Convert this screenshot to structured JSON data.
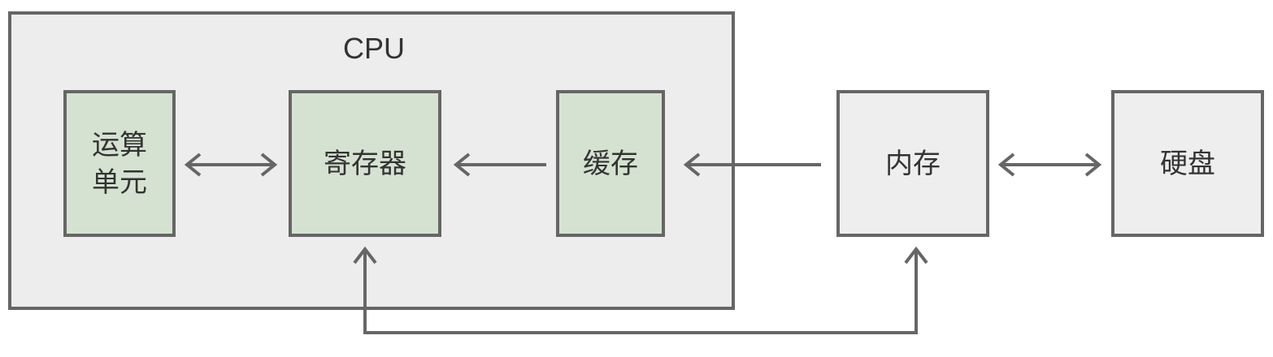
{
  "diagram": {
    "caption_fragment": "",
    "cpu": {
      "label": "CPU"
    },
    "nodes": {
      "alu": "运算单元",
      "register": "寄存器",
      "cache": "缓存",
      "memory": "内存",
      "disk": "硬盘"
    },
    "colors": {
      "cpu_background": "#ededed",
      "component_fill": "#d5e2d1",
      "external_fill": "#eeeeee",
      "stroke": "#666666"
    },
    "edges": [
      {
        "from": "alu",
        "to": "register",
        "direction": "bidirectional"
      },
      {
        "from": "cache",
        "to": "register",
        "direction": "one-way"
      },
      {
        "from": "memory",
        "to": "cache",
        "direction": "one-way"
      },
      {
        "from": "memory",
        "to": "disk",
        "direction": "bidirectional"
      },
      {
        "from": "register",
        "to": "memory",
        "direction": "bidirectional",
        "route": "below"
      }
    ]
  }
}
